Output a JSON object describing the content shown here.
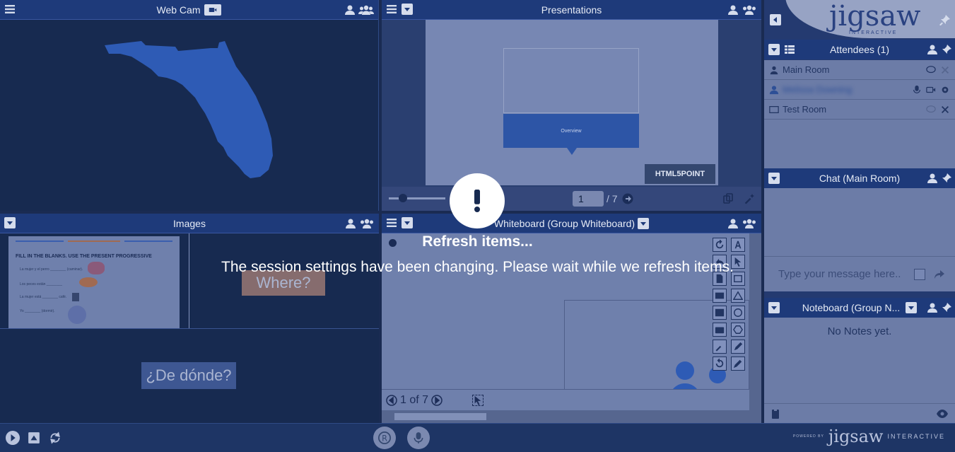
{
  "webcam": {
    "title": "Web Cam"
  },
  "presentations": {
    "title": "Presentations",
    "slide_label": "Overview",
    "logo_text": "HTML5POINT",
    "page_value": "1",
    "page_total": "/ 7"
  },
  "images": {
    "title": "Images",
    "worksheet_title": "FILL IN THE BLANKS. USE THE PRESENT PROGRESSIVE",
    "worksheet_lines": [
      "La mujer y el perro ________ (caminar).",
      "Los peces están ________",
      "La mujer está ________ café.",
      "Yo ________ (dormir)."
    ],
    "label_where": "Where?",
    "label_donde": "¿De dónde?"
  },
  "whiteboard": {
    "title": "Whiteboard (Group Whiteboard)",
    "page_text": "1 of 7"
  },
  "sidebar": {
    "logo": "jigsaw",
    "logo_sub": "INTERACTIVE",
    "attendees_title": "Attendees (1)",
    "attendees": [
      {
        "name": "Main Room",
        "type": "room"
      },
      {
        "name": "Melissa Downing",
        "type": "user"
      },
      {
        "name": "Test Room",
        "type": "room"
      }
    ],
    "chat_title": "Chat (Main Room)",
    "chat_placeholder": "Type your message here..",
    "notes_title": "Noteboard (Group N...",
    "notes_empty": "No Notes yet."
  },
  "bottom": {
    "powered_by": "POWERED BY",
    "brand": "jigsaw",
    "brand_sub": "INTERACTIVE"
  },
  "overlay": {
    "title": "Refresh items...",
    "message": "The session settings have been changing. Please wait while we refresh items."
  },
  "colors": {
    "header": "#1e3a7a",
    "background": "#1a2b52",
    "accent": "#2d55a6"
  }
}
